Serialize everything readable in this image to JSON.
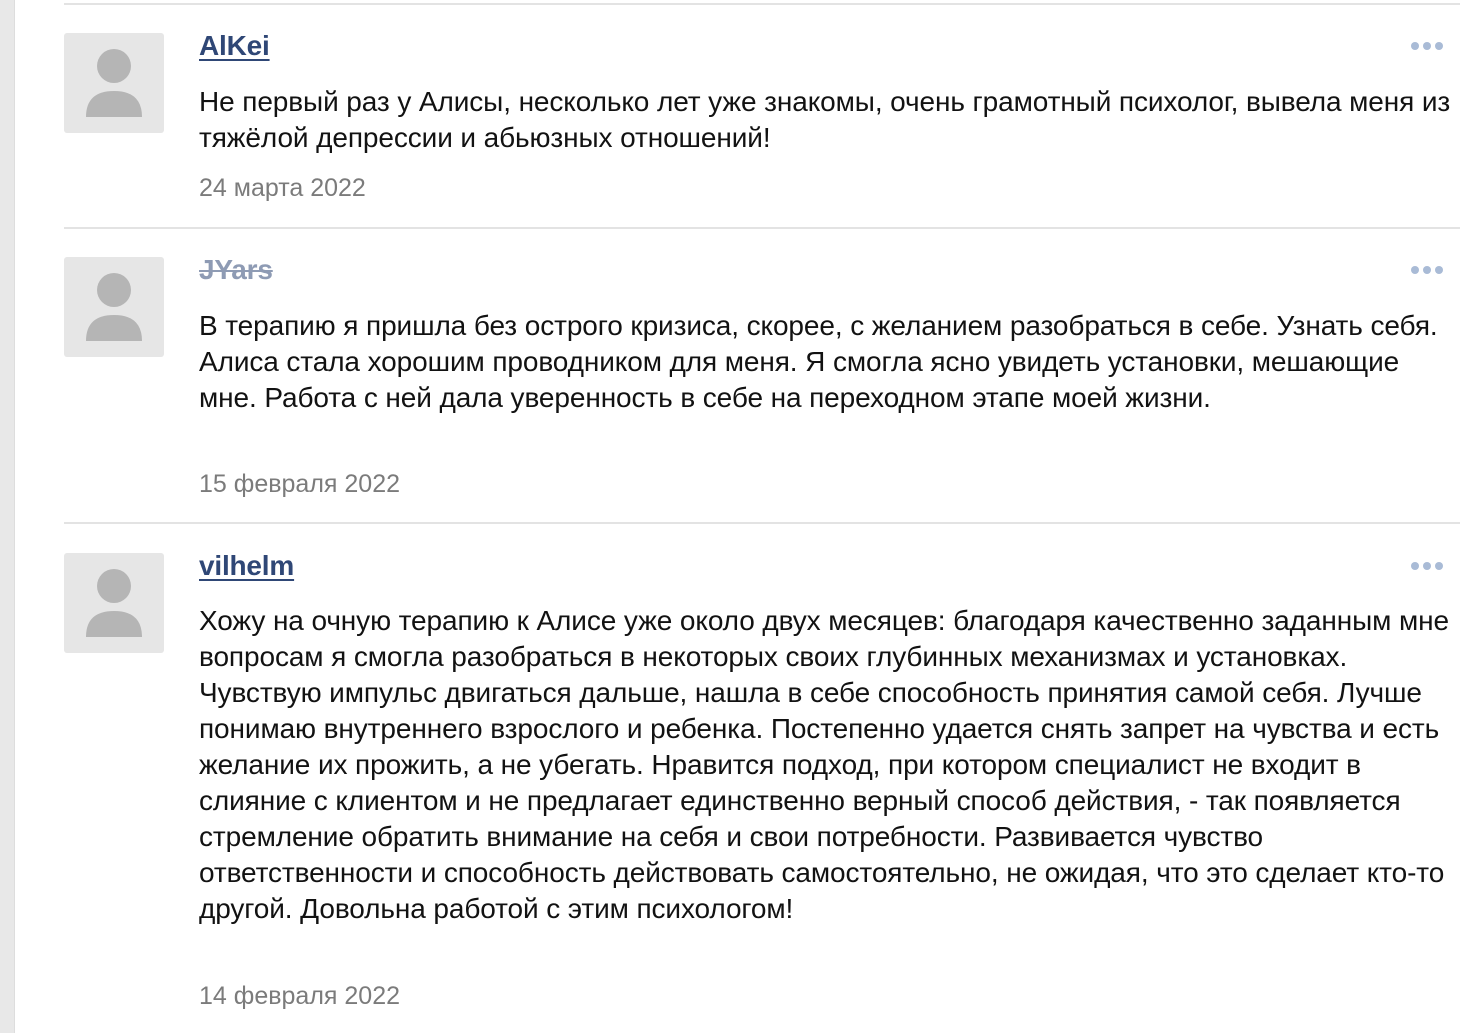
{
  "colors": {
    "author_link": "#2f4776",
    "author_deleted": "#8e9bb4",
    "date": "#7b7b7b",
    "divider": "#e3e3e3",
    "avatar_bg": "#e6e6e6",
    "avatar_figure": "#b5b5b5",
    "more_dots": "#a9bbd6"
  },
  "icons": {
    "avatar": "default-user-silhouette-icon",
    "more": "more-horizontal-dots-icon"
  },
  "reviews": [
    {
      "author": "AlKei",
      "text": "Не первый раз у Алисы, несколько лет уже знакомы, очень грамотный психолог, вывела меня из тяжёлой депрессии и абьюзных отношений!",
      "date": "24 марта 2022"
    },
    {
      "author": "JYars",
      "text": "В терапию я пришла без острого кризиса, скорее, с желанием разобраться в себе. Узнать себя. Алиса стала хорошим проводником для меня. Я смогла ясно увидеть установки, мешающие мне. Работа с ней дала уверенность в себе на переходном этапе моей жизни.",
      "date": "15 февраля 2022"
    },
    {
      "author": "vilhelm",
      "text": "Хожу на очную терапию к Алисе уже около двух месяцев: благодаря качественно заданным мне вопросам я смогла разобраться в некоторых своих глубинных механизмах и установках. Чувствую импульс двигаться дальше, нашла в себе способность принятия самой себя. Лучше понимаю внутреннего взрослого и ребенка. Постепенно удается снять запрет на чувства и есть желание их прожить, а не убегать. Нравится подход, при котором специалист не входит в слияние с клиентом и не предлагает единственно верный способ действия, - так появляется стремление обратить внимание на себя и свои потребности. Развивается чувство ответственности и способность действовать самостоятельно, не ожидая, что это сделает кто-то другой. Довольна работой с этим психологом!",
      "date": "14 февраля 2022"
    }
  ]
}
